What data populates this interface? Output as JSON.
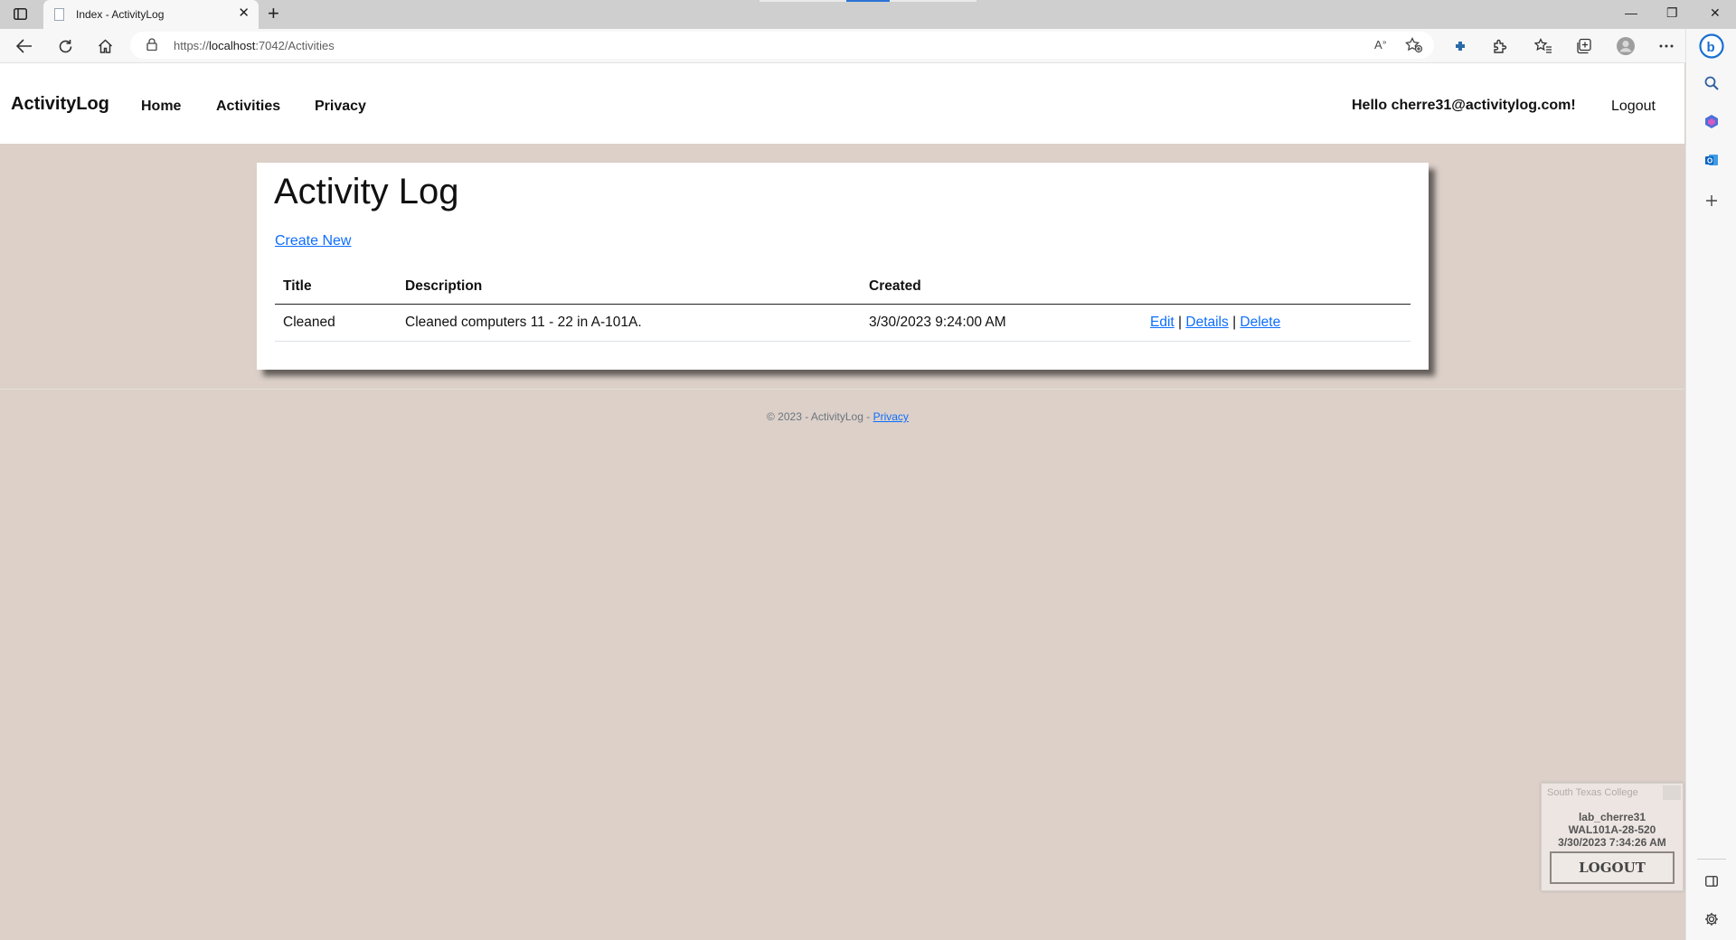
{
  "browser": {
    "tab_title": "Index - ActivityLog",
    "new_tab_symbol": "+",
    "close_symbol": "✕",
    "url_scheme": "https://",
    "url_host": "localhost",
    "url_rest": ":7042/Activities",
    "minimize_symbol": "—",
    "restore_symbol": "❐",
    "close_window_symbol": "✕"
  },
  "navbar": {
    "brand": "ActivityLog",
    "links": [
      "Home",
      "Activities",
      "Privacy"
    ],
    "greeting": "Hello cherre31@activitylog.com!",
    "logout": "Logout"
  },
  "main": {
    "heading": "Activity Log",
    "create_new": "Create New",
    "table": {
      "headers": [
        "Title",
        "Description",
        "Created"
      ],
      "rows": [
        {
          "title": "Cleaned",
          "description": "Cleaned computers 11 - 22 in A-101A.",
          "created": "3/30/2023 9:24:00 AM",
          "edit": "Edit",
          "details": "Details",
          "delete": "Delete",
          "sep": "|"
        }
      ]
    }
  },
  "footer": {
    "text": "© 2023 - ActivityLog - ",
    "privacy": "Privacy"
  },
  "session_widget": {
    "college": "South Texas College",
    "user": "lab_cherre31",
    "machine": "WAL101A-28-520",
    "timestamp": "3/30/2023 7:34:26 AM",
    "logout": "LOGOUT"
  },
  "colors": {
    "page_bg": "#dcd0c9",
    "link": "#0d6efd",
    "browser_frame": "#cfcfcf",
    "bing_blue": "#1a6fd1"
  }
}
